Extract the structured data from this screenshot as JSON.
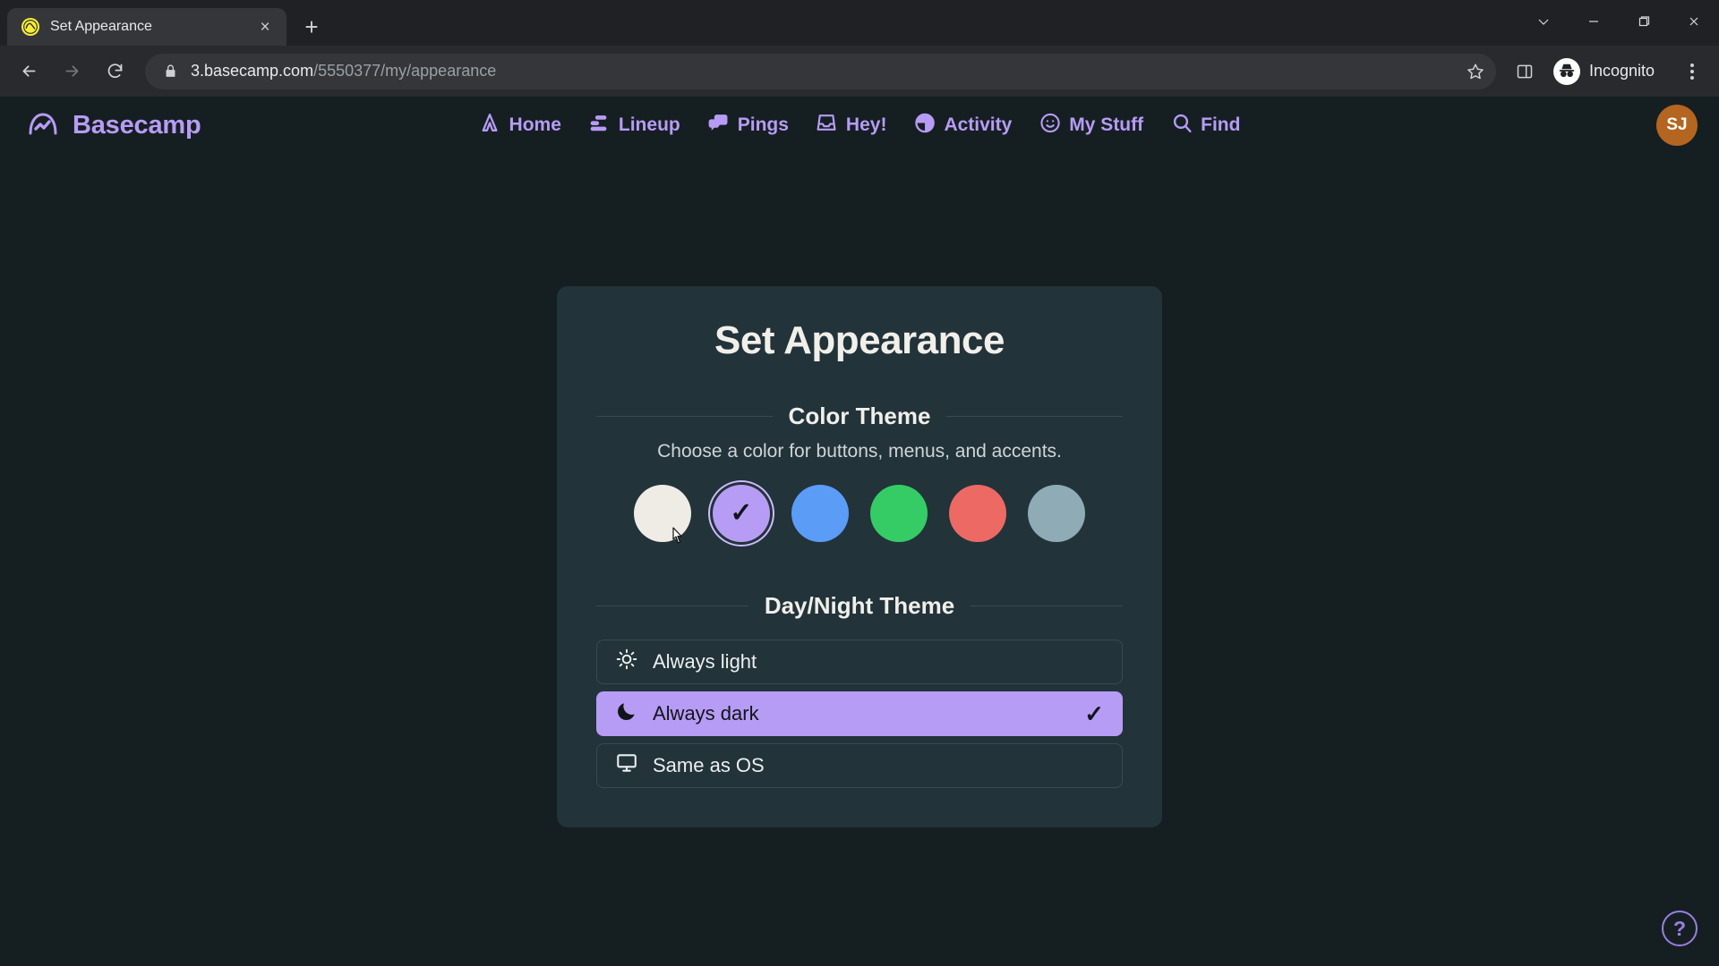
{
  "browser": {
    "tab": {
      "title": "Set Appearance",
      "favicon": "basecamp-favicon",
      "close_label": "×"
    },
    "new_tab_label": "+",
    "window_controls": {
      "minimize_group": "v",
      "minimize": "–",
      "maximize": "❐",
      "close": "✕"
    },
    "nav": {
      "back": "back-arrow",
      "forward": "forward-arrow",
      "reload": "reload-arrow"
    },
    "omnibox": {
      "lock": "lock-icon",
      "url_host": "3.basecamp.com",
      "url_path": "/5550377/my/appearance",
      "bookmark": "star-icon"
    },
    "side_panel": "side-panel-icon",
    "profile": {
      "label": "Incognito",
      "icon": "incognito-icon"
    },
    "menu": "three-dot-menu"
  },
  "app": {
    "brand": "Basecamp",
    "nav_items": [
      {
        "label": "Home",
        "icon": "home-icon"
      },
      {
        "label": "Lineup",
        "icon": "lineup-icon"
      },
      {
        "label": "Pings",
        "icon": "pings-icon"
      },
      {
        "label": "Hey!",
        "icon": "hey-inbox-icon"
      },
      {
        "label": "Activity",
        "icon": "activity-pie-icon"
      },
      {
        "label": "My Stuff",
        "icon": "smiley-icon"
      },
      {
        "label": "Find",
        "icon": "search-icon"
      }
    ],
    "avatar_initials": "SJ",
    "help_label": "?"
  },
  "card": {
    "title": "Set Appearance",
    "color_theme": {
      "heading": "Color Theme",
      "description": "Choose a color for buttons, menus, and accents.",
      "check_mark": "✓",
      "swatches": [
        {
          "name": "white",
          "color": "#efece5",
          "selected": false
        },
        {
          "name": "purple",
          "color": "#b79cf5",
          "selected": true
        },
        {
          "name": "blue",
          "color": "#5b9cf7",
          "selected": false
        },
        {
          "name": "green",
          "color": "#35cc66",
          "selected": false
        },
        {
          "name": "red",
          "color": "#ec6a63",
          "selected": false
        },
        {
          "name": "slate",
          "color": "#8fabb5",
          "selected": false
        }
      ]
    },
    "day_night_theme": {
      "heading": "Day/Night Theme",
      "check_mark": "✓",
      "options": [
        {
          "label": "Always light",
          "icon": "sun-icon",
          "selected": false
        },
        {
          "label": "Always dark",
          "icon": "moon-icon",
          "selected": true
        },
        {
          "label": "Same as OS",
          "icon": "monitor-icon",
          "selected": false
        }
      ]
    }
  },
  "colors": {
    "page_bg": "#151f22",
    "card_bg": "#22333a",
    "accent": "#b79cf5",
    "avatar_bg": "#b4651f"
  }
}
